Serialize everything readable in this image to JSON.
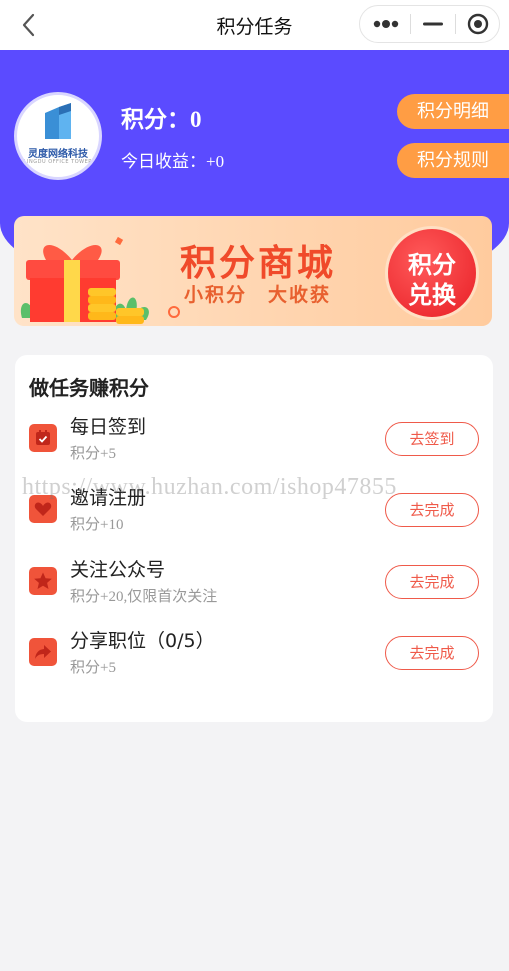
{
  "nav": {
    "title": "积分任务"
  },
  "header": {
    "avatar": {
      "name": "灵度网络科技",
      "sub": "LINGDU OFFICE TOWER"
    },
    "points_label": "积分：",
    "points_value": "0",
    "income_label": "今日收益：",
    "income_value": "+0",
    "buttons": {
      "detail": "积分明细",
      "rules": "积分规则"
    }
  },
  "banner": {
    "title": "积分商城",
    "subtitle": "小积分　大收获",
    "circle_line1": "积分",
    "circle_line2": "兑换"
  },
  "tasks": {
    "title": "做任务赚积分",
    "items": [
      {
        "name": "每日签到",
        "desc": "积分+5",
        "button": "去签到",
        "icon": "calendar-check-icon"
      },
      {
        "name": "邀请注册",
        "desc": "积分+10",
        "button": "去完成",
        "icon": "heart-icon"
      },
      {
        "name": "关注公众号",
        "desc": "积分+20,仅限首次关注",
        "button": "去完成",
        "icon": "star-icon"
      },
      {
        "name": "分享职位（0/5）",
        "desc": "积分+5",
        "button": "去完成",
        "icon": "share-icon"
      }
    ]
  },
  "watermark": "https://www.huzhan.com/ishop47855",
  "colors": {
    "brand": "#5b4bff",
    "accent": "#ff9d44",
    "task_red": "#ef5a4a"
  }
}
